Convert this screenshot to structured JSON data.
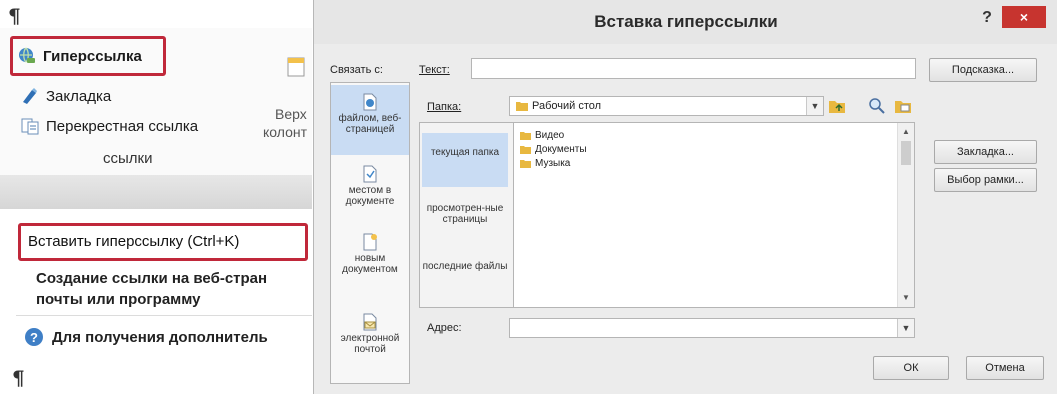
{
  "document": {
    "paragraph_mark": "¶"
  },
  "ribbon": {
    "items": [
      {
        "label": "Гиперссылка",
        "icon": "globe-link-icon"
      },
      {
        "label": "Закладка",
        "icon": "bookmark-icon"
      },
      {
        "label": "Перекрестная ссылка",
        "icon": "cross-reference-icon"
      }
    ],
    "group_label": "ссылки",
    "cut_button_label_top": "Верх",
    "cut_button_label_bottom": "колонт"
  },
  "tooltip": {
    "title": "Вставить гиперссылку (Ctrl+K)",
    "description_line1": "Создание ссылки на веб-стран",
    "description_line2": "почты или программу",
    "help_text": "Для получения дополнитель"
  },
  "dialog": {
    "title": "Вставка гиперссылки",
    "help_button": "?",
    "close_button": "×",
    "link_to_label": "Связать с:",
    "text_label": "Текст:",
    "text_value": "",
    "tooltip_button": "Подсказка...",
    "folder_label": "Папка:",
    "folder_value": "Рабочий стол",
    "address_label": "Адрес:",
    "address_value": "",
    "link_bar": [
      {
        "label": "файлом, веб-страницей",
        "icon": "file-web-icon",
        "selected": true
      },
      {
        "label": "местом в документе",
        "icon": "place-in-document-icon",
        "selected": false
      },
      {
        "label": "новым документом",
        "icon": "new-document-icon",
        "selected": false
      },
      {
        "label": "электронной почтой",
        "icon": "email-icon",
        "selected": false
      }
    ],
    "browse_sections": [
      {
        "label": "текущая папка",
        "selected": true
      },
      {
        "label": "просмотрен-ные страницы",
        "selected": false
      },
      {
        "label": "последние файлы",
        "selected": false
      }
    ],
    "files": [
      "Видео",
      "Документы",
      "Музыка"
    ],
    "bookmark_button": "Закладка...",
    "target_frame_button": "Выбор рамки...",
    "ok_button": "ОК",
    "cancel_button": "Отмена"
  },
  "colors": {
    "highlight_border": "#c0283a",
    "close_button": "#c7342f",
    "selection": "#c9dcf3"
  }
}
